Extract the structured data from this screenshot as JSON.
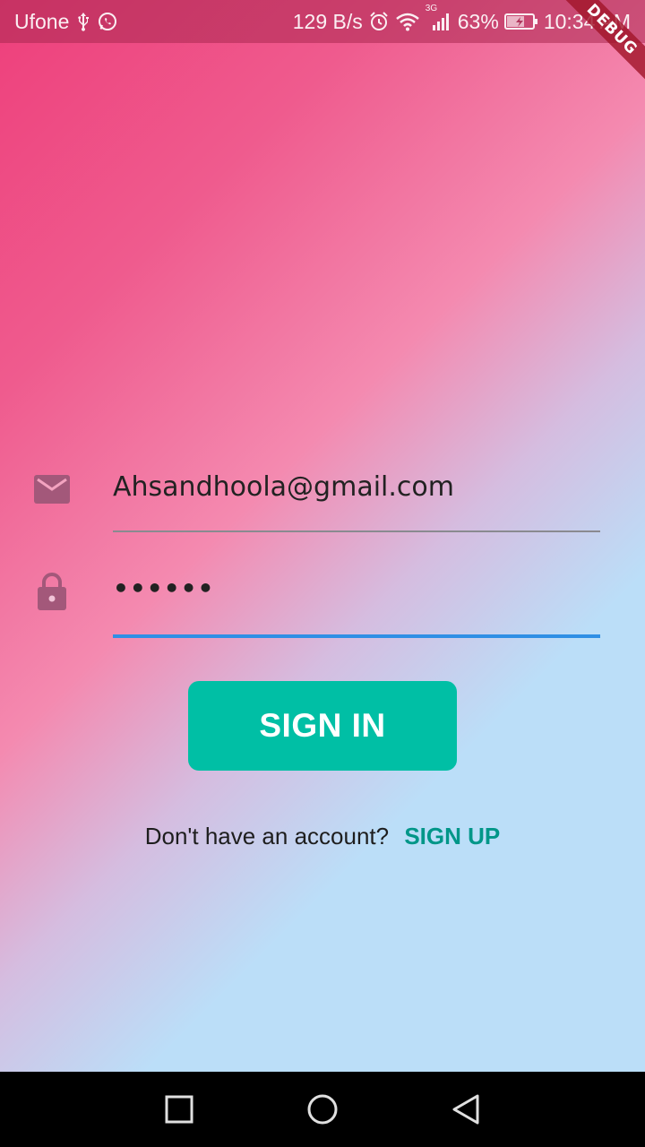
{
  "status_bar": {
    "carrier": "Ufone",
    "network_speed": "129 B/s",
    "network_type": "3G",
    "battery": "63%",
    "time": "10:34 AM",
    "icons": [
      "usb-icon",
      "whatsapp-icon",
      "alarm-icon",
      "wifi-icon",
      "signal-icon",
      "battery-charging-icon"
    ]
  },
  "debug_banner": "DEBUG",
  "login_form": {
    "email_value": "Ahsandhoola@gmail.com",
    "password_value": "••••••",
    "email_icon": "mail-icon",
    "password_icon": "lock-icon",
    "signin_label": "SIGN IN"
  },
  "signup_prompt": {
    "text": "Don't have an account?",
    "link_label": "SIGN UP"
  },
  "navigation": {
    "buttons": [
      "recent-apps",
      "home",
      "back"
    ]
  },
  "colors": {
    "accent": "#00bfa5",
    "link": "#009688",
    "focus_underline": "#2f8fe5",
    "gradient_pink": "#ee3f7b",
    "gradient_blue": "#bbdef8"
  }
}
